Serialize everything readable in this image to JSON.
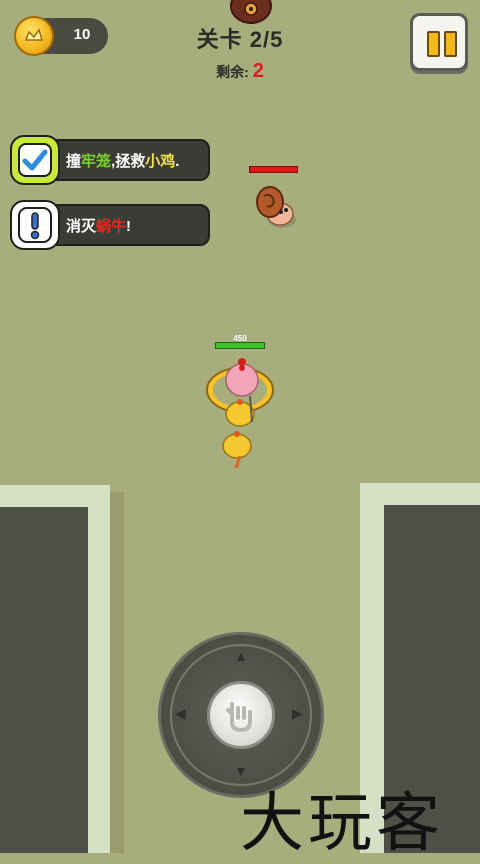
{
  "hud": {
    "coins": "10",
    "level_label": "关卡 2/5",
    "remaining_label": "剩余:",
    "remaining_count": "2"
  },
  "missions": [
    {
      "parts": [
        "撞",
        "牢笼",
        ",拯救",
        "小鸡",
        "."
      ],
      "status": "complete"
    },
    {
      "parts": [
        "消灭",
        "蜗牛",
        "!"
      ],
      "status": "active"
    }
  ],
  "player": {
    "hp_label": "450"
  },
  "controls": {
    "arrows": [
      "▲",
      "▼",
      "◀",
      "▶"
    ]
  },
  "watermark": "大玩客",
  "colors": {
    "ground": "#a8ad7e",
    "wall_top": "#d6e0c5",
    "wall_inner": "#4d5045",
    "enemy_hp": "#e01818",
    "player_hp": "#3cc226"
  }
}
